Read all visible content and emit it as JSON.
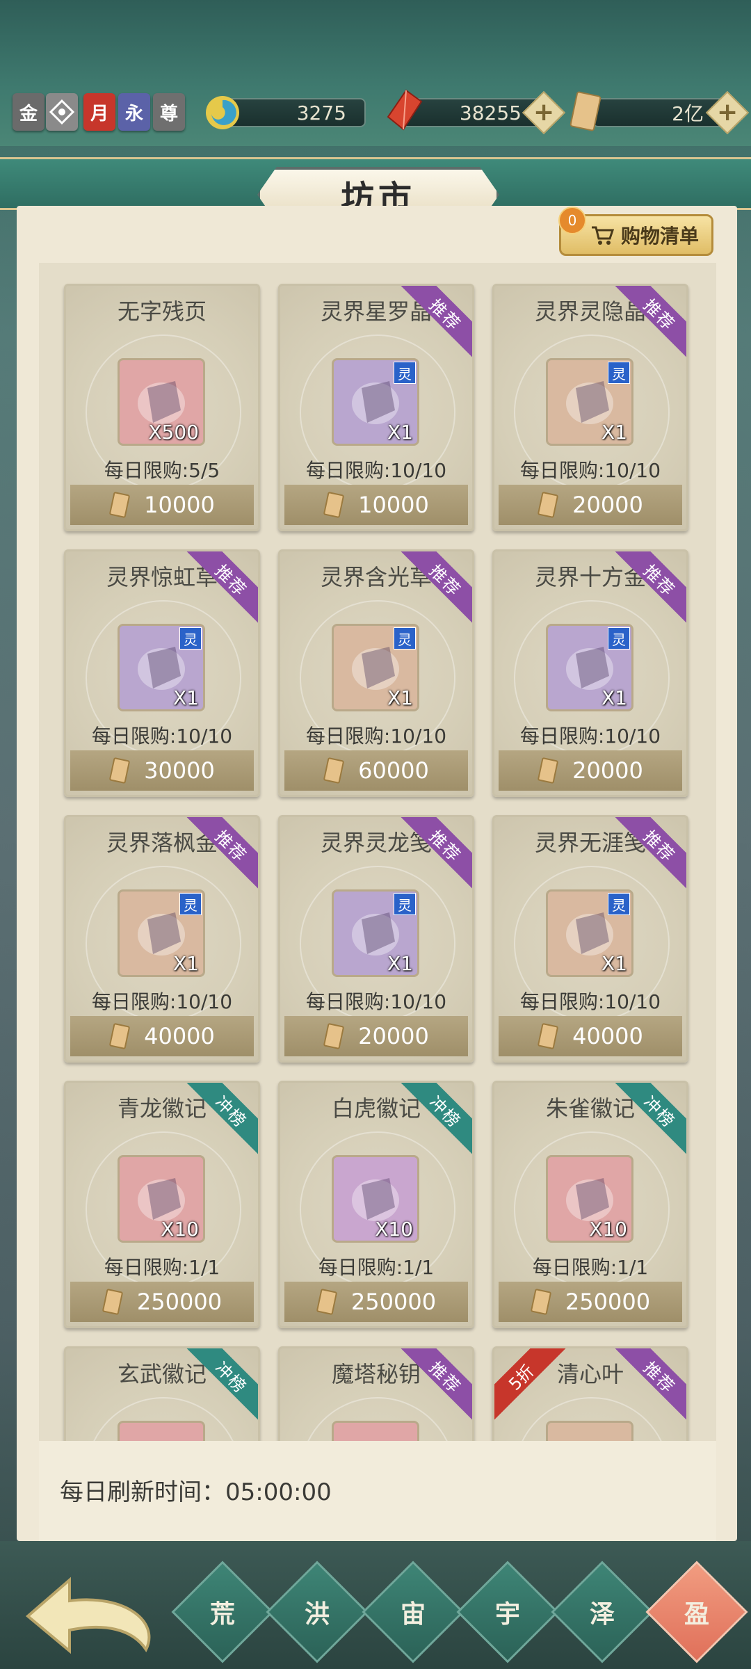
{
  "header": {
    "badges": [
      {
        "label": "金",
        "color": "#6b6b6b"
      },
      {
        "label": "",
        "color": "#7a7a7a"
      },
      {
        "label": "月",
        "color": "#c7362b"
      },
      {
        "label": "永",
        "color": "#5b62a8"
      },
      {
        "label": "尊",
        "color": "#6f6f6f"
      }
    ],
    "currencies": {
      "jade": "3275",
      "crystal": "38255",
      "scroll": "2亿"
    }
  },
  "shop": {
    "title": "坊市",
    "cart": {
      "label": "购物清单",
      "count": "0"
    },
    "items": [
      {
        "name": "无字残页",
        "qty": "X500",
        "limit": "每日限购:5/5",
        "price": "10000",
        "tag": "",
        "ribbon": "",
        "bg": "#e0a6a6"
      },
      {
        "name": "灵界星罗晶",
        "qty": "X1",
        "limit": "每日限购:10/10",
        "price": "10000",
        "tag": "灵",
        "ribbon": "推荐",
        "bg": "#b9a6cf"
      },
      {
        "name": "灵界灵隐晶",
        "qty": "X1",
        "limit": "每日限购:10/10",
        "price": "20000",
        "tag": "灵",
        "ribbon": "推荐",
        "bg": "#d9b9a0"
      },
      {
        "name": "灵界惊虹草",
        "qty": "X1",
        "limit": "每日限购:10/10",
        "price": "30000",
        "tag": "灵",
        "ribbon": "推荐",
        "bg": "#b9a6cf"
      },
      {
        "name": "灵界含光草",
        "qty": "X1",
        "limit": "每日限购:10/10",
        "price": "60000",
        "tag": "灵",
        "ribbon": "推荐",
        "bg": "#d9b9a0"
      },
      {
        "name": "灵界十方金",
        "qty": "X1",
        "limit": "每日限购:10/10",
        "price": "20000",
        "tag": "灵",
        "ribbon": "推荐",
        "bg": "#b9a6cf"
      },
      {
        "name": "灵界落枫金",
        "qty": "X1",
        "limit": "每日限购:10/10",
        "price": "40000",
        "tag": "灵",
        "ribbon": "推荐",
        "bg": "#d9b9a0"
      },
      {
        "name": "灵界灵龙笺",
        "qty": "X1",
        "limit": "每日限购:10/10",
        "price": "20000",
        "tag": "灵",
        "ribbon": "推荐",
        "bg": "#b9a6cf"
      },
      {
        "name": "灵界无涯笺",
        "qty": "X1",
        "limit": "每日限购:10/10",
        "price": "40000",
        "tag": "灵",
        "ribbon": "推荐",
        "bg": "#d9b9a0"
      },
      {
        "name": "青龙徽记",
        "qty": "X10",
        "limit": "每日限购:1/1",
        "price": "250000",
        "tag": "",
        "ribbon": "冲榜",
        "bg": "#e0a6a6"
      },
      {
        "name": "白虎徽记",
        "qty": "X10",
        "limit": "每日限购:1/1",
        "price": "250000",
        "tag": "",
        "ribbon": "冲榜",
        "bg": "#c9a6cf"
      },
      {
        "name": "朱雀徽记",
        "qty": "X10",
        "limit": "每日限购:1/1",
        "price": "250000",
        "tag": "",
        "ribbon": "冲榜",
        "bg": "#e0a6a6"
      },
      {
        "name": "玄武徽记",
        "qty": "",
        "limit": "",
        "price": "",
        "tag": "",
        "ribbon": "冲榜",
        "bg": "#e0a6a6"
      },
      {
        "name": "魔塔秘钥",
        "qty": "",
        "limit": "",
        "price": "",
        "tag": "",
        "ribbon": "推荐",
        "bg": "#e0a6a6"
      },
      {
        "name": "清心叶",
        "qty": "",
        "limit": "",
        "price": "",
        "tag": "",
        "ribbon": "推荐",
        "discount": "5折",
        "bg": "#d9b9a0"
      }
    ],
    "refresh_label": "每日刷新时间：",
    "refresh_time": "05:00:00"
  },
  "nav": {
    "tabs": [
      "荒",
      "洪",
      "宙",
      "宇",
      "泽",
      "盈"
    ],
    "active": "盈"
  }
}
